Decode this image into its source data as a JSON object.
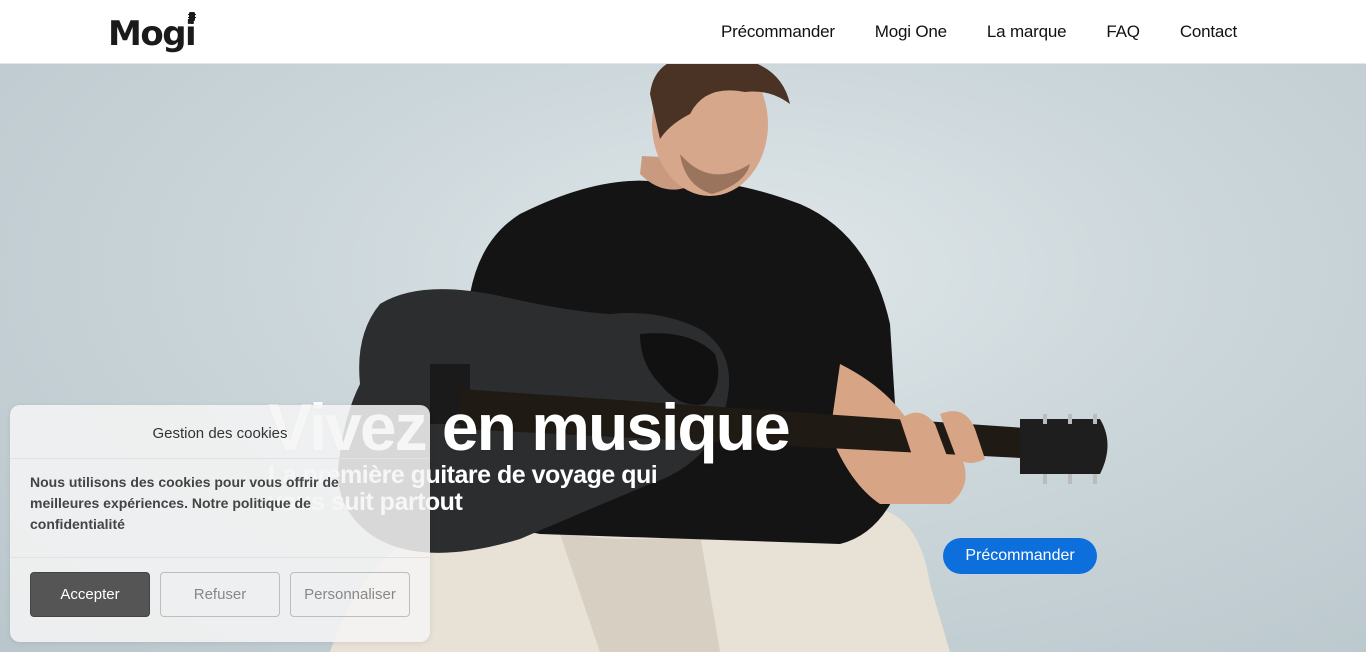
{
  "header": {
    "logo_text": "Mogi",
    "nav": [
      "Précommander",
      "Mogi One",
      "La marque",
      "FAQ",
      "Contact"
    ]
  },
  "hero": {
    "title": "Vivez en musique",
    "subtitle": "La première guitare de voyage qui vous suit partout",
    "cta_label": "Précommander"
  },
  "cookie_banner": {
    "title": "Gestion des cookies",
    "text": "Nous utilisons des cookies pour vous offrir de meilleures expériences. Notre politique de confidentialité",
    "accept_label": "Accepter",
    "refuse_label": "Refuser",
    "customize_label": "Personnaliser"
  },
  "colors": {
    "accent": "#0c6fdc",
    "accept_button": "#555555"
  }
}
